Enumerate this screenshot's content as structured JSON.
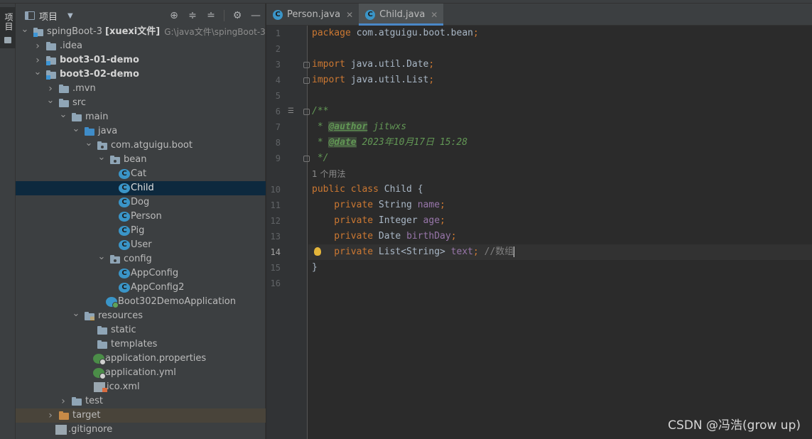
{
  "left_stripe": {
    "label": "项目"
  },
  "project_panel": {
    "title": "项目",
    "tools": [
      "globe-icon",
      "expand-all-icon",
      "collapse-all-icon",
      "settings-icon",
      "hide-icon"
    ]
  },
  "tree": [
    {
      "depth": 0,
      "chev": "open",
      "icon": "module-folder",
      "label": "spingBoot-3",
      "bold_suffix": "[xuexi文件]",
      "hint": "G:\\java文件\\spingBoot-3"
    },
    {
      "depth": 1,
      "chev": "closed",
      "icon": "folder",
      "label": ".idea"
    },
    {
      "depth": 1,
      "chev": "closed",
      "icon": "module-folder",
      "label": "boot3-01-demo",
      "bold": true
    },
    {
      "depth": 1,
      "chev": "open",
      "icon": "module-folder",
      "label": "boot3-02-demo",
      "bold": true
    },
    {
      "depth": 2,
      "chev": "closed",
      "icon": "folder",
      "label": ".mvn"
    },
    {
      "depth": 2,
      "chev": "open",
      "icon": "folder",
      "label": "src"
    },
    {
      "depth": 3,
      "chev": "open",
      "icon": "folder",
      "label": "main"
    },
    {
      "depth": 4,
      "chev": "open",
      "icon": "blue-folder",
      "label": "java"
    },
    {
      "depth": 5,
      "chev": "open",
      "icon": "package-folder",
      "label": "com.atguigu.boot"
    },
    {
      "depth": 6,
      "chev": "open",
      "icon": "package-folder",
      "label": "bean"
    },
    {
      "depth": 7,
      "chev": "none",
      "icon": "class",
      "label": "Cat"
    },
    {
      "depth": 7,
      "chev": "none",
      "icon": "class",
      "label": "Child",
      "selected": true
    },
    {
      "depth": 7,
      "chev": "none",
      "icon": "class",
      "label": "Dog"
    },
    {
      "depth": 7,
      "chev": "none",
      "icon": "class",
      "label": "Person"
    },
    {
      "depth": 7,
      "chev": "none",
      "icon": "class",
      "label": "Pig"
    },
    {
      "depth": 7,
      "chev": "none",
      "icon": "class",
      "label": "User"
    },
    {
      "depth": 6,
      "chev": "open",
      "icon": "package-folder",
      "label": "config"
    },
    {
      "depth": 7,
      "chev": "none",
      "icon": "class",
      "label": "AppConfig"
    },
    {
      "depth": 7,
      "chev": "none",
      "icon": "class",
      "label": "AppConfig2"
    },
    {
      "depth": 6,
      "chev": "none",
      "icon": "app-class",
      "label": "Boot302DemoApplication"
    },
    {
      "depth": 4,
      "chev": "open",
      "icon": "resources-folder",
      "label": "resources"
    },
    {
      "depth": 5,
      "chev": "none",
      "icon": "folder",
      "label": "static"
    },
    {
      "depth": 5,
      "chev": "none",
      "icon": "folder",
      "label": "templates"
    },
    {
      "depth": 5,
      "chev": "none",
      "icon": "spring-file",
      "label": "application.properties"
    },
    {
      "depth": 5,
      "chev": "none",
      "icon": "spring-file",
      "label": "application.yml"
    },
    {
      "depth": 5,
      "chev": "none",
      "icon": "xml-file",
      "label": "ico.xml"
    },
    {
      "depth": 3,
      "chev": "closed",
      "icon": "folder",
      "label": "test"
    },
    {
      "depth": 2,
      "chev": "closed",
      "icon": "orange-folder",
      "label": "target",
      "excluded": true
    },
    {
      "depth": 2,
      "chev": "none",
      "icon": "file",
      "label": ".gitignore"
    }
  ],
  "tabs": [
    {
      "label": "Person.java",
      "active": false
    },
    {
      "label": "Child.java",
      "active": true
    }
  ],
  "code": {
    "current_line": 14,
    "usage_hint": "1 个用法",
    "lines": [
      {
        "n": 1,
        "parts": [
          [
            "kw",
            "package "
          ],
          [
            "",
            "com.atguigu.boot.bean"
          ],
          [
            "kw",
            ";"
          ]
        ]
      },
      {
        "n": 2,
        "parts": []
      },
      {
        "n": 3,
        "parts": [
          [
            "kw",
            "import "
          ],
          [
            "",
            "java.util.Date"
          ],
          [
            "kw",
            ";"
          ]
        ],
        "fold": true
      },
      {
        "n": 4,
        "parts": [
          [
            "kw",
            "import "
          ],
          [
            "",
            "java.util.List"
          ],
          [
            "kw",
            ";"
          ]
        ],
        "fold": true
      },
      {
        "n": 5,
        "parts": []
      },
      {
        "n": 6,
        "parts": [
          [
            "cmt",
            "/**"
          ]
        ],
        "fold": true,
        "doc": true
      },
      {
        "n": 7,
        "parts": [
          [
            "cmt",
            " * "
          ],
          [
            "tag",
            "@author"
          ],
          [
            "cmt",
            " jitwxs"
          ]
        ]
      },
      {
        "n": 8,
        "parts": [
          [
            "cmt",
            " * "
          ],
          [
            "tag",
            "@date"
          ],
          [
            "cmt",
            " 2023年10月17日 15:28"
          ]
        ]
      },
      {
        "n": 9,
        "parts": [
          [
            "cmt",
            " */"
          ]
        ],
        "fold": true
      },
      {
        "n": 10,
        "parts": [
          [
            "kw",
            "public class "
          ],
          [
            "",
            "Child {"
          ]
        ]
      },
      {
        "n": 11,
        "parts": [
          [
            "kw",
            "    private "
          ],
          [
            "",
            "String "
          ],
          [
            "fld",
            "name"
          ],
          [
            "kw",
            ";"
          ]
        ]
      },
      {
        "n": 12,
        "parts": [
          [
            "kw",
            "    private "
          ],
          [
            "",
            "Integer "
          ],
          [
            "fld",
            "age"
          ],
          [
            "kw",
            ";"
          ]
        ]
      },
      {
        "n": 13,
        "parts": [
          [
            "kw",
            "    private "
          ],
          [
            "",
            "Date "
          ],
          [
            "fld",
            "birthDay"
          ],
          [
            "kw",
            ";"
          ]
        ]
      },
      {
        "n": 14,
        "parts": [
          [
            "kw",
            "    private "
          ],
          [
            "",
            "List<String> "
          ],
          [
            "fld",
            "text"
          ],
          [
            "kw",
            "; "
          ],
          [
            "grey",
            "//数组"
          ]
        ],
        "bulb": true
      },
      {
        "n": 15,
        "parts": [
          [
            "",
            "}"
          ]
        ]
      },
      {
        "n": 16,
        "parts": []
      }
    ]
  },
  "watermark": "CSDN @冯浩(grow up)"
}
